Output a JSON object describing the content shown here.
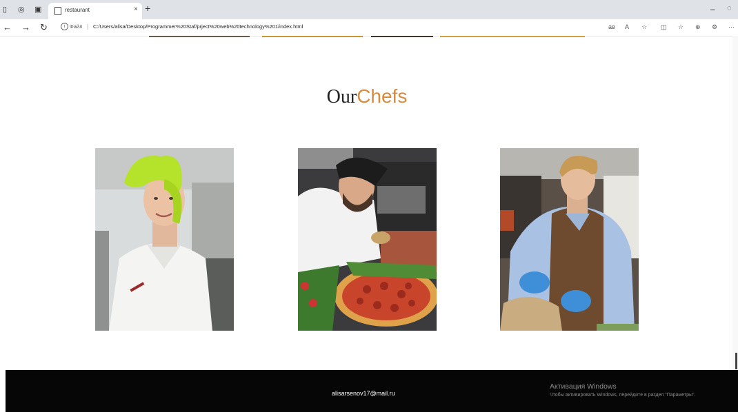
{
  "browser": {
    "tab_title": "restaurant",
    "tab_close": "×",
    "new_tab": "+",
    "file_label": "Файл",
    "separator": "|",
    "url": "C:/Users/alisa/Desktop/Programmer%20Staf/prject%20web%20technology%201/index.html",
    "toolbar_icons": [
      "read-aloud-icon",
      "text-size-icon",
      "favorite-star-icon",
      "split-screen-icon",
      "favorites-icon",
      "collections-icon",
      "extensions-icon",
      "more-icon"
    ]
  },
  "page": {
    "heading_part1": "Our",
    "heading_part2": "Chefs",
    "accent_color": "#d98a3c",
    "chefs": [
      {
        "image": "chef-green-hat-photo"
      },
      {
        "image": "chef-pizza-photo"
      },
      {
        "image": "chef-apron-photo"
      }
    ],
    "footer_email": "alisarsenov17@mail.ru"
  },
  "watermark": {
    "title": "Активация Windows",
    "text": "Чтобы активировать Windows, перейдите в раздел \"Параметры\"."
  }
}
